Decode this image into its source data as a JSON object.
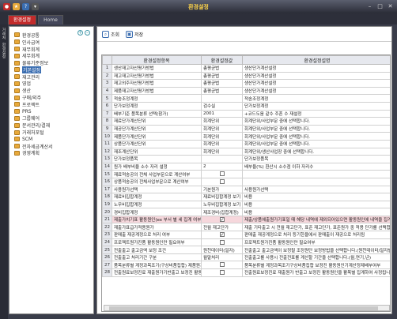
{
  "app": {
    "title": "환경설정"
  },
  "tabs": [
    {
      "label": "환경설정",
      "active": true
    },
    {
      "label": "Home",
      "active": false
    }
  ],
  "side_strip": [
    "거래처",
    "환경설정"
  ],
  "tree": {
    "items": [
      {
        "label": "환경공통"
      },
      {
        "label": "인사급여"
      },
      {
        "label": "재무회계"
      },
      {
        "label": "세무회계"
      },
      {
        "label": "물류기준정보"
      },
      {
        "label": "기본설정",
        "selected": true
      },
      {
        "label": "재고관리"
      },
      {
        "label": "영업"
      },
      {
        "label": "생산"
      },
      {
        "label": "구매/외주"
      },
      {
        "label": "프로젝트"
      },
      {
        "label": "PRS"
      },
      {
        "label": "그룹웨어"
      },
      {
        "label": "문서관리/결재"
      },
      {
        "label": "거래처포털"
      },
      {
        "label": "SCM"
      },
      {
        "label": "전자세금계산서"
      },
      {
        "label": "경영계획"
      }
    ]
  },
  "toolbar": {
    "search_label": "조회",
    "save_label": "저장"
  },
  "grid": {
    "headers": [
      "환경설정항목",
      "환경설정값",
      "환경설정설명"
    ],
    "rows": [
      {
        "no": "1",
        "item": "생산재고자산평가방법",
        "value": "총평균법",
        "desc": "생산단가계산설정",
        "hl": false
      },
      {
        "no": "2",
        "item": "재고재고자산평가방법",
        "value": "총평균법",
        "desc": "생산단가계산설정",
        "hl": false
      },
      {
        "no": "3",
        "item": "재고외주자산평가방법",
        "value": "총평균법",
        "desc": "생산단가계산설정",
        "hl": false
      },
      {
        "no": "4",
        "item": "제품재고자산평가방법",
        "value": "총평균법",
        "desc": "생산단가계산설정",
        "hl": false
      },
      {
        "no": "5",
        "item": "적송조정계정",
        "value": "",
        "desc": "적송조정계정",
        "hl": false
      },
      {
        "no": "6",
        "item": "단가보정계정",
        "value": "검수실",
        "desc": "단가보정계정",
        "hl": false
      },
      {
        "no": "7",
        "item": "배부기준 품목분류 선택(참가)",
        "value": "2001",
        "desc": "+코드도움 같수 주혼 수 재설정",
        "hl": false
      },
      {
        "no": "8",
        "item": "재료단가계산단위",
        "value": "회계단위",
        "desc": "회계단위/사업부문 중에 선택합니다.",
        "hl": false
      },
      {
        "no": "9",
        "item": "재공단가계산단위",
        "value": "회계단위",
        "desc": "회계단위/사업부문 중에 선택합니다.",
        "hl": false
      },
      {
        "no": "10",
        "item": "제품단가계산단위",
        "value": "회계단위",
        "desc": "회계단위/사업부문 중에 선택합니다.",
        "hl": false
      },
      {
        "no": "11",
        "item": "상품단가계산단위",
        "value": "회계단위",
        "desc": "회계단위/사업부문 중에 선택합니다.",
        "hl": false
      },
      {
        "no": "12",
        "item": "재조계산단위",
        "value": "회계단위",
        "desc": "회계단위/생산사업장 중에 선택합니다.",
        "hl": false
      },
      {
        "no": "13",
        "item": "단가보정품목",
        "value": "",
        "desc": "단가보정품목",
        "hl": false
      },
      {
        "no": "14",
        "item": "원가 배부비율 소수 자리 설정",
        "value": "2",
        "desc": "배부율(%) 환산시 소수점 이하 자리수",
        "hl": false
      },
      {
        "no": "15",
        "item": "재료적송공의 전체 사업부문으로 계산여부",
        "value": "cb0",
        "desc": "",
        "hl": false
      },
      {
        "no": "16",
        "item": "상품적송공의 전체사업부문으로 계산여부",
        "value": "cb0",
        "desc": "",
        "hl": false
      },
      {
        "no": "17",
        "item": "사용원가선택",
        "value": "기본원가",
        "desc": "사용원가선택",
        "hl": false
      },
      {
        "no": "18",
        "item": "재료비집합계정",
        "value": "재료비집합계정 보기",
        "desc": "비용",
        "hl": false
      },
      {
        "no": "19",
        "item": "노무비집합계정",
        "value": "노무비집합계정 보기",
        "desc": "비용",
        "hl": false
      },
      {
        "no": "20",
        "item": "경비집합계정",
        "value": "제조경비(집합계정)",
        "desc": "비용",
        "hl": false
      },
      {
        "no": "21",
        "item": "제출가치기표 활동원인(ex 부서 별 세 집계 여부",
        "value": "cb1",
        "desc": "제출/상품에출원가기표일 때 해당 내역에 제외되어있으면 활동원인에 내역을 집계합니다.",
        "hl": true
      },
      {
        "no": "22",
        "item": "재출가표급가적용원가",
        "value": "전월 재고단가",
        "desc": "재출 기타출고 시 전월 재고단가, 표준 재고단가, 표준원가 중 적용 단가를 선택합니다.",
        "hl": false
      },
      {
        "no": "23",
        "item": "판매출 재공계정으로 처리 여부",
        "value": "cb1",
        "desc": "판매출 재공계정으로 처리 등기한을에서 판매출이 재공으로 처리됨",
        "hl": false
      },
      {
        "no": "24",
        "item": "프로젝트원가진품 활동원인만 필요여부",
        "value": "cb0",
        "desc": "프로젝트원가진품 활동원인만 필요여부",
        "hl": false
      },
      {
        "no": "25",
        "item": "전출출고 출고금액 보정 조건",
        "value": "원천데이터(일자)",
        "desc": "전출출고 출고금액이 보정될 조정원단 보정방법을 선택합니다.(원천데이터/일자별/출고부)",
        "hl": false
      },
      {
        "no": "26",
        "item": "전출출고 처리기간 구분",
        "value": "월말처리",
        "desc": "전출출고를 사용시 전출전표를 계산할 기간을 선택합니다.(월,연기,년)",
        "hl": false
      },
      {
        "no": "27",
        "item": "품목분류별 계정과목조기(구상비품집합) 제품원가계산",
        "value": "cb0",
        "desc": "품목분류별 계정과목조기구상비품집합 보정진 활동원인기계산정제배부여부",
        "hl": false
      },
      {
        "no": "28",
        "item": "전출원료보정진료 재출원가기반출고 보정진 활동원인",
        "value": "cb0",
        "desc": "전출원료보정진료 재출원가 반출고 보정진 활동원인을 활목별 집계하여 사정됩니다.",
        "hl": false
      }
    ]
  }
}
